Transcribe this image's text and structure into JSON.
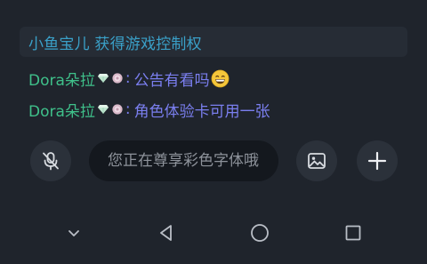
{
  "system_message": "小鱼宝儿 获得游戏控制权",
  "chat": [
    {
      "username": "Dora朵拉",
      "badges": [
        "diamond-badge-icon",
        "flower-badge-icon"
      ],
      "colon": ":",
      "message": "公告有看吗",
      "emoji": "grinning-face-icon"
    },
    {
      "username": "Dora朵拉",
      "badges": [
        "diamond-badge-icon",
        "flower-badge-icon"
      ],
      "colon": ":",
      "message": "角色体验卡可用一张"
    }
  ],
  "input": {
    "placeholder": "您正在尊享彩色字体哦"
  },
  "icons": {
    "mic": "mic-off-icon",
    "image": "image-icon",
    "plus": "plus-icon"
  },
  "nav": {
    "down": "chevron-down-icon",
    "back": "back-triangle-icon",
    "home": "home-circle-icon",
    "recent": "recent-apps-square-icon"
  },
  "colors": {
    "background": "#1f242c",
    "username": "#3fc08a",
    "message": "#7b7ff0",
    "system": "#3aa0c8"
  }
}
